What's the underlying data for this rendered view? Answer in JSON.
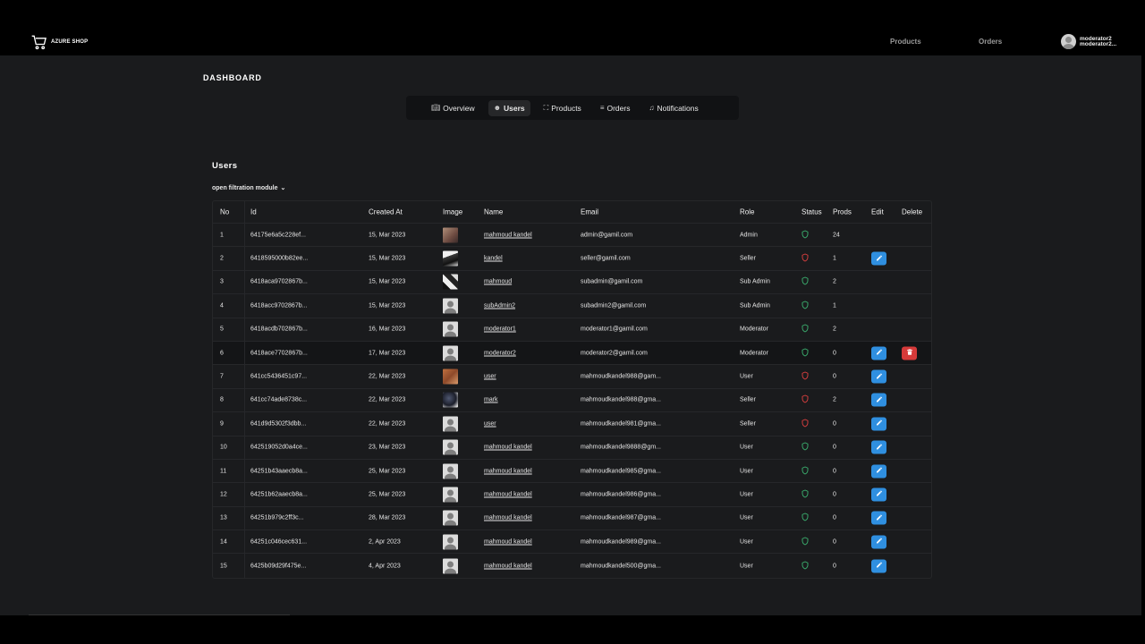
{
  "brand": {
    "name": "AZURE SHOP",
    "icon": "cart-icon"
  },
  "nav": {
    "products": "Products",
    "orders": "Orders"
  },
  "user": {
    "name": "moderator2",
    "subname": "moderator2..."
  },
  "page_title": "DASHBOARD",
  "tabs": [
    {
      "label": "Overview",
      "icon": "book-icon",
      "active": false
    },
    {
      "label": "Users",
      "icon": "users-icon",
      "active": true
    },
    {
      "label": "Products",
      "icon": "cart-icon",
      "active": false
    },
    {
      "label": "Orders",
      "icon": "list-icon",
      "active": false
    },
    {
      "label": "Notifications",
      "icon": "bell-icon",
      "active": false
    }
  ],
  "section_title": "Users",
  "filter_label": "open filtration module",
  "colors": {
    "status_ok": "#3cb371",
    "status_bad": "#e04040",
    "edit": "#2f8fe0",
    "delete": "#d63a3a"
  },
  "table": {
    "headers": {
      "no": "No",
      "id": "Id",
      "created": "Created At",
      "image": "Image",
      "name": "Name",
      "email": "Email",
      "role": "Role",
      "status": "Status",
      "prods": "Prods",
      "edit": "Edit",
      "delete": "Delete"
    },
    "rows": [
      {
        "no": "1",
        "id": "64175e6a5c228ef...",
        "created": "15, Mar 2023",
        "image": "photo-a",
        "name": "mahmoud kandel",
        "email": "admin@gamil.com",
        "role": "Admin",
        "status": "ok",
        "prods": "24",
        "edit": false,
        "delete": false
      },
      {
        "no": "2",
        "id": "6418595000b82ee...",
        "created": "15, Mar 2023",
        "image": "photo-b",
        "name": "kandel",
        "email": "seller@gamil.com",
        "role": "Seller",
        "status": "bad",
        "prods": "1",
        "edit": true,
        "delete": false
      },
      {
        "no": "3",
        "id": "6418aca9702867b...",
        "created": "15, Mar 2023",
        "image": "photo-c",
        "name": "mahmoud",
        "email": "subadmin@gamil.com",
        "role": "Sub Admin",
        "status": "ok",
        "prods": "2",
        "edit": false,
        "delete": false
      },
      {
        "no": "4",
        "id": "6418acc9702867b...",
        "created": "15, Mar 2023",
        "image": "default",
        "name": "subAdmin2",
        "email": "subadmin2@gamil.com",
        "role": "Sub Admin",
        "status": "ok",
        "prods": "1",
        "edit": false,
        "delete": false
      },
      {
        "no": "5",
        "id": "6418acdb702867b...",
        "created": "16, Mar 2023",
        "image": "default",
        "name": "moderator1",
        "email": "moderator1@gamil.com",
        "role": "Moderator",
        "status": "ok",
        "prods": "2",
        "edit": false,
        "delete": false
      },
      {
        "no": "6",
        "id": "6418ace7702867b...",
        "created": "17, Mar 2023",
        "image": "default",
        "name": "moderator2",
        "email": "moderator2@gamil.com",
        "role": "Moderator",
        "status": "ok",
        "prods": "0",
        "edit": true,
        "delete": true
      },
      {
        "no": "7",
        "id": "641cc5436451c97...",
        "created": "22, Mar 2023",
        "image": "photo-d",
        "name": "user",
        "email": "mahmoudkandel988@gam...",
        "role": "User",
        "status": "bad",
        "prods": "0",
        "edit": true,
        "delete": false
      },
      {
        "no": "8",
        "id": "641cc74ade8738c...",
        "created": "22, Mar 2023",
        "image": "photo-e",
        "name": "mark",
        "email": "mahmoudkandel988@gma...",
        "role": "Seller",
        "status": "bad",
        "prods": "2",
        "edit": true,
        "delete": false
      },
      {
        "no": "9",
        "id": "641d9d5302f3dbb...",
        "created": "22, Mar 2023",
        "image": "default",
        "name": "user",
        "email": "mahmoudkandel981@gma...",
        "role": "Seller",
        "status": "bad",
        "prods": "0",
        "edit": true,
        "delete": false
      },
      {
        "no": "10",
        "id": "642519052d0a4ce...",
        "created": "23, Mar 2023",
        "image": "default",
        "name": "mahmoud kandel",
        "email": "mahmoudkandel9888@gm...",
        "role": "User",
        "status": "ok",
        "prods": "0",
        "edit": true,
        "delete": false
      },
      {
        "no": "11",
        "id": "64251b43aaecb8a...",
        "created": "25, Mar 2023",
        "image": "default",
        "name": "mahmoud kandel",
        "email": "mahmoudkandel985@gma...",
        "role": "User",
        "status": "ok",
        "prods": "0",
        "edit": true,
        "delete": false
      },
      {
        "no": "12",
        "id": "64251b62aaecb8a...",
        "created": "25, Mar 2023",
        "image": "default",
        "name": "mahmoud kandel",
        "email": "mahmoudkandel986@gma...",
        "role": "User",
        "status": "ok",
        "prods": "0",
        "edit": true,
        "delete": false
      },
      {
        "no": "13",
        "id": "64251b979c2ff3c...",
        "created": "28, Mar 2023",
        "image": "default",
        "name": "mahmoud kandel",
        "email": "mahmoudkandel987@gma...",
        "role": "User",
        "status": "ok",
        "prods": "0",
        "edit": true,
        "delete": false
      },
      {
        "no": "14",
        "id": "64251c046cec631...",
        "created": "2, Apr 2023",
        "image": "default",
        "name": "mahmoud kandel",
        "email": "mahmoudkandel989@gma...",
        "role": "User",
        "status": "ok",
        "prods": "0",
        "edit": true,
        "delete": false
      },
      {
        "no": "15",
        "id": "6425b09d29f475e...",
        "created": "4, Apr 2023",
        "image": "default",
        "name": "mahmoud kandel",
        "email": "mahmoudkandel500@gma...",
        "role": "User",
        "status": "ok",
        "prods": "0",
        "edit": true,
        "delete": false
      }
    ]
  }
}
